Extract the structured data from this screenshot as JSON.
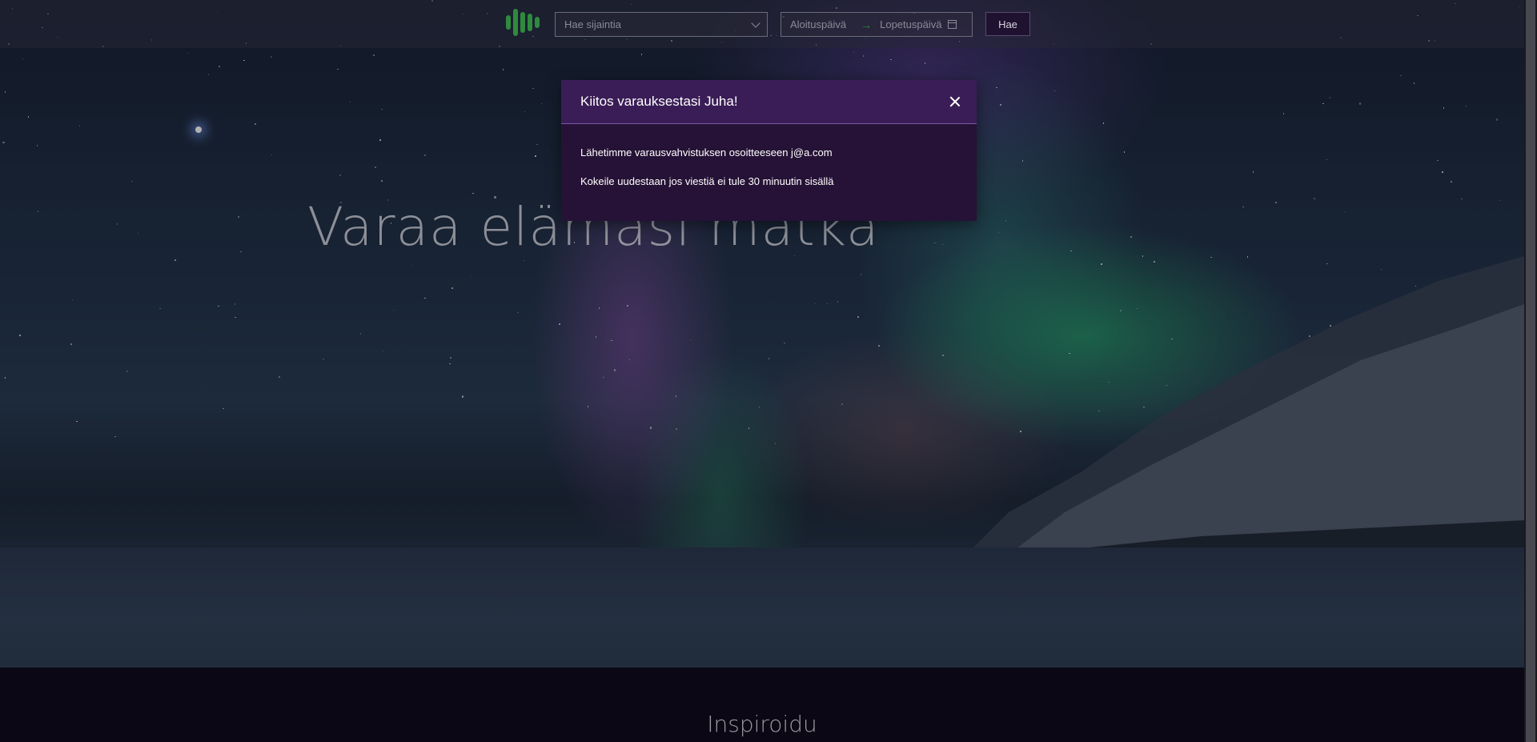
{
  "nav": {
    "location_placeholder": "Hae sijaintia",
    "start_date_placeholder": "Aloituspäivä",
    "end_date_placeholder": "Lopetuspäivä",
    "date_separator": "→",
    "search_label": "Hae",
    "icons": [
      "logo-bars-icon",
      "chevron-down-icon",
      "calendar-icon"
    ]
  },
  "hero": {
    "title": "Varaa elämäsi matka"
  },
  "modal": {
    "title": "Kiitos varauksestasi Juha!",
    "line1": "Lähetimme varausvahvistuksen osoitteeseen j@a.com",
    "line2": "Kokeile uudestaan jos viestiä ei tule 30 minuutin sisällä"
  },
  "section": {
    "title": "Inspiroidu"
  },
  "colors": {
    "accent_green": "#2f8a3e",
    "modal_bg": "#261236",
    "modal_header_bg": "#3a1d56"
  }
}
